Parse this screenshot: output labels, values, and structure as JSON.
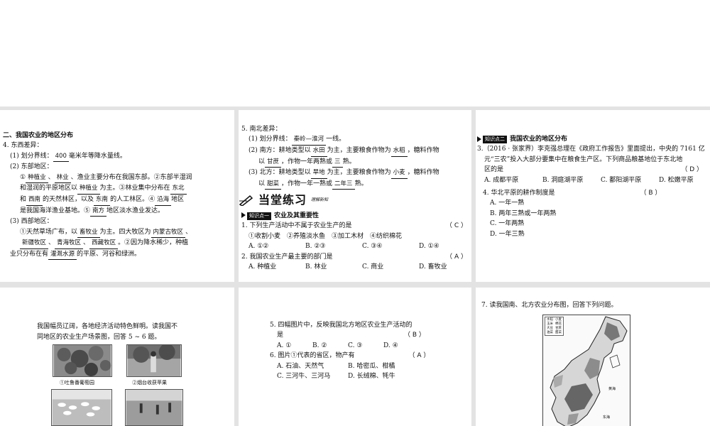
{
  "p1": {
    "section": "二、我国农业的地区分布",
    "l1": "4. 东西差异：",
    "l2a": "(1) 划分界线：",
    "a400": "400",
    "l2b": "毫米年等降水量线。",
    "l3": "(2) 东部地区：",
    "l4a": "①",
    "a_zzy": "种植业",
    "l4b": "、",
    "a_ly": "林业",
    "l4c": "、渔业主要分布在我国东部。②东部半湿润",
    "l5a": "和湿润的平原地区以",
    "a_zzy2": "种植业",
    "l5b": "为主。③林业集中分布在",
    "a_db": "东北",
    "l6a": "和",
    "a_xn": "西南",
    "l6b": "的天然林区，以及",
    "a_dn": "东南",
    "l6c": "的人工林区。④",
    "a_yh": "沿海",
    "l6d": "地区",
    "l7a": "是我国海洋渔业基地。⑤",
    "a_nf": "南方",
    "l7b": "地区淡水渔业发达。",
    "l8": "(3) 西部地区：",
    "l9a": "①天然草场广布，以",
    "a_xmy": "畜牧业",
    "l9b": "为主。四大牧区为",
    "a_nmg": "内蒙古牧区",
    "l9c": "、",
    "a_xj": "新疆牧区",
    "l10a": "、",
    "a_qh": "青海牧区",
    "l10b": "、",
    "a_xz": "西藏牧区",
    "l10c": "。②因为降水稀少，种植",
    "l11a": "业只分布在有",
    "a_ggsy": "灌溉水源",
    "l11b": "的平原、河谷和绿洲。"
  },
  "p2": {
    "l1": "5. 南北差异：",
    "l2a": "(1) 划分界线：",
    "a_qlhh": "秦岭—淮河",
    "l2b": "一线。",
    "l3a": "(2) 南方：耕地类型以",
    "a_st": "水田",
    "l3b": "为主，主要粮食作物为",
    "a_sd": "水稻",
    "l3c": "，糖料作物",
    "l4a": "以",
    "a_gz": "甘蔗",
    "l4b": "，作物一年两熟或",
    "a_san": "三",
    "l4c": "熟。",
    "l5a": "(3) 北方：耕地类型以",
    "a_hd": "旱地",
    "l5b": "为主，主要粮食作物为",
    "a_xm": "小麦",
    "l5c": "，糖料作物",
    "l6a": "以",
    "a_tc": "甜菜",
    "l6b": "，作物一年一熟或",
    "a_enss": "二年三",
    "l6c": "熟。",
    "banner_title": "当堂练习",
    "banner_sub": "理解新知",
    "tag": "知识点一",
    "topic": "农业及其重要性",
    "q1": "1. 下列生产活动中不属于农业生产的是",
    "q1ans": "（ C ）",
    "q1items": "①收割小麦　②养殖淡水鱼　③加工木材　④纺织棉花",
    "q1o": [
      "A. ①②",
      "B. ②③",
      "C. ③④",
      "D. ①④"
    ],
    "q2": "2. 我国农业生产最主要的部门是",
    "q2ans": "（ A ）",
    "q2o": [
      "A. 种植业",
      "B. 林业",
      "C. 商业",
      "D. 畜牧业"
    ]
  },
  "p3": {
    "tag": "知识点二",
    "topic": "我国农业的地区分布",
    "q3a": "3.（2016 · 张家界）李克强总理在《政府工作报告》里面提出，中央的 7161 亿",
    "q3b": "元“三农”投入大部分要集中在粮食生产区。下列商品粮基地位于东北地",
    "q3c": "区的是",
    "q3ans": "（ D ）",
    "q3o": [
      "A. 成都平原",
      "B. 洞庭湖平原",
      "C. 鄱阳湖平原",
      "D. 松嫩平原"
    ],
    "q4": "4. 华北平原的耕作制度是",
    "q4ans": "（ B ）",
    "q4o": [
      "A. 一年一熟",
      "B. 两年三熟或一年两熟",
      "C. 一年两熟",
      "D. 一年三熟"
    ]
  },
  "p4": {
    "intro1": "我国幅员辽阔，各地经济活动特色鲜明。读我国不",
    "intro2": "同地区的农业生产场景图，回答 5 ~ 6 题。",
    "cap1": "①吐鲁番葡萄园",
    "cap2": "②烟台收获苹果"
  },
  "p5": {
    "q5a": "5. 四幅图片中，反映我国北方地区农业生产活动的",
    "q5b": "是",
    "q5ans": "（ B ）",
    "q5o": [
      "A. ①",
      "B. ②",
      "C. ③",
      "D. ④"
    ],
    "q6": "6. 图片①代表的省区，物产有",
    "q6ans": "（ A ）",
    "q6o": [
      "A. 石油、天然气",
      "B. 哈密瓜、柑橘",
      "C. 三河牛、三河马",
      "D. 长绒棉、牦牛"
    ]
  },
  "p6": {
    "q7": "7. 读我国南、北方农业分布图，回答下列问题。",
    "legend": [
      "水稻",
      "小麦",
      "玉米",
      "棉花",
      "大豆",
      "甘蔗",
      "油菜",
      "甜菜"
    ],
    "map_label_huanghai": "黄海",
    "map_label_donghai": "东海"
  }
}
